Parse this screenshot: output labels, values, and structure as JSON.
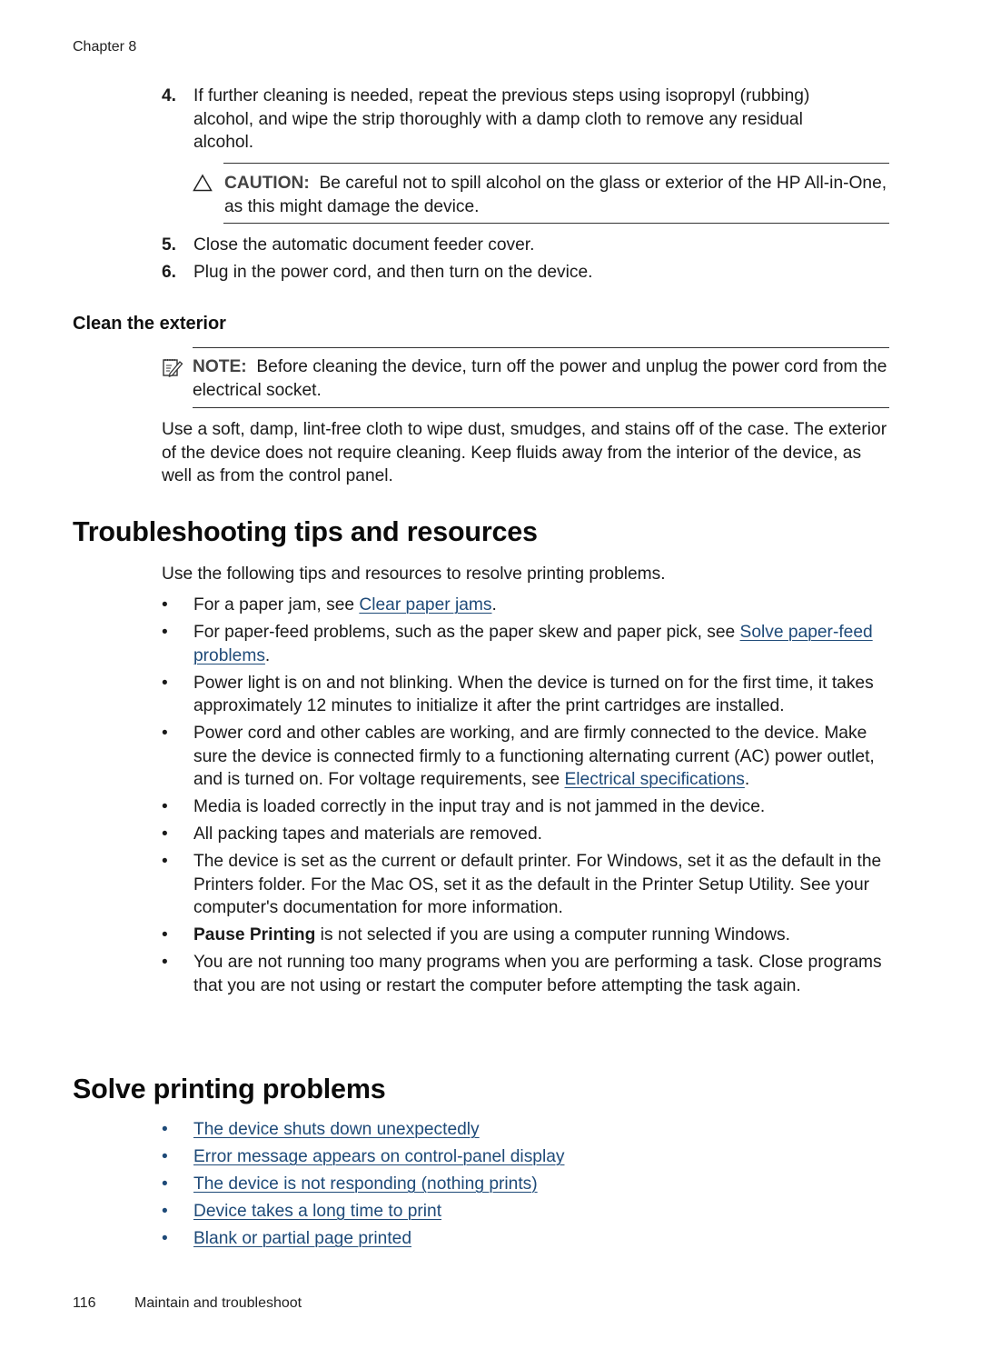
{
  "header": {
    "running_head": "Chapter 8"
  },
  "steps_top": [
    {
      "num": "4.",
      "text": "If further cleaning is needed, repeat the previous steps using isopropyl (rubbing) alcohol, and wipe the strip thoroughly with a damp cloth to remove any residual alcohol."
    }
  ],
  "caution": {
    "icon": "caution-triangle-icon",
    "label": "CAUTION:",
    "text": "Be careful not to spill alcohol on the glass or exterior of the HP All-in-One, as this might damage the device."
  },
  "steps_bottom": [
    {
      "num": "5.",
      "text": "Close the automatic document feeder cover."
    },
    {
      "num": "6.",
      "text": "Plug in the power cord, and then turn on the device."
    }
  ],
  "clean_exterior": {
    "heading": "Clean the exterior",
    "note": {
      "icon": "note-pencil-icon",
      "label": "NOTE:",
      "text": "Before cleaning the device, turn off the power and unplug the power cord from the electrical socket."
    },
    "paragraph": "Use a soft, damp, lint-free cloth to wipe dust, smudges, and stains off of the case. The exterior of the device does not require cleaning. Keep fluids away from the interior of the device, as well as from the control panel."
  },
  "troubleshooting": {
    "heading": "Troubleshooting tips and resources",
    "intro": "Use the following tips and resources to resolve printing problems.",
    "bullet_glyph": "•",
    "items": [
      {
        "before": "For a paper jam, see ",
        "link": "Clear paper jams",
        "after": "."
      },
      {
        "before": "For paper-feed problems, such as the paper skew and paper pick, see ",
        "link": "Solve paper-feed problems",
        "after": "."
      },
      {
        "text": "Power light is on and not blinking. When the device is turned on for the first time, it takes approximately 12 minutes to initialize it after the print cartridges are installed."
      },
      {
        "before": "Power cord and other cables are working, and are firmly connected to the device. Make sure the device is connected firmly to a functioning alternating current (AC) power outlet, and is turned on. For voltage requirements, see ",
        "link": "Electrical specifications",
        "after": "."
      },
      {
        "text": "Media is loaded correctly in the input tray and is not jammed in the device."
      },
      {
        "text": "All packing tapes and materials are removed."
      },
      {
        "text": "The device is set as the current or default printer. For Windows, set it as the default in the Printers folder. For the Mac OS, set it as the default in the Printer Setup Utility. See your computer's documentation for more information."
      },
      {
        "bold": "Pause Printing",
        "after": " is not selected if you are using a computer running Windows."
      },
      {
        "text": "You are not running too many programs when you are performing a task. Close programs that you are not using or restart the computer before attempting the task again."
      }
    ]
  },
  "solve_printing": {
    "heading": "Solve printing problems",
    "links": [
      "The device shuts down unexpectedly",
      "Error message appears on control-panel display",
      "The device is not responding (nothing prints)",
      "Device takes a long time to print",
      "Blank or partial page printed"
    ]
  },
  "footer": {
    "page_number": "116",
    "section": "Maintain and troubleshoot"
  },
  "colors": {
    "link": "#1e4a78",
    "text": "#1a1a1a",
    "rule": "#333333"
  }
}
